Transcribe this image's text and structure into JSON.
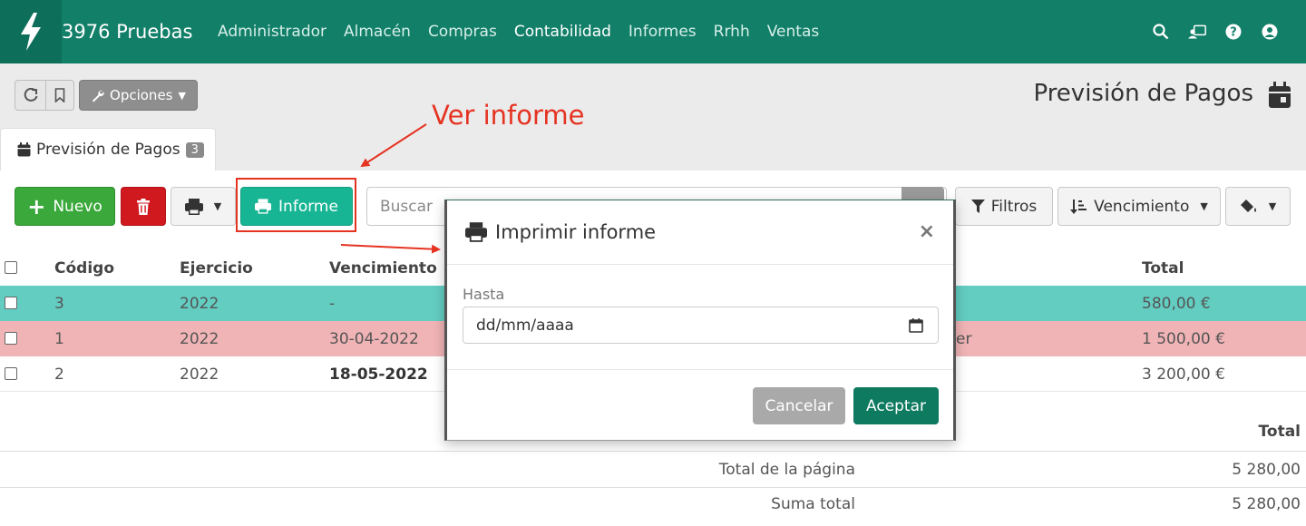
{
  "navbar": {
    "brand": "3976 Pruebas",
    "links": [
      "Administrador",
      "Almacén",
      "Compras",
      "Contabilidad",
      "Informes",
      "Rrhh",
      "Ventas"
    ],
    "active_link": "Contabilidad",
    "icons": [
      "search-icon",
      "contacts-icon",
      "help-icon",
      "user-icon"
    ]
  },
  "header": {
    "options_label": "Opciones",
    "page_title": "Previsión de Pagos",
    "tab_label": "Previsión de Pagos",
    "tab_count": "3"
  },
  "toolbar": {
    "new_label": "Nuevo",
    "report_label": "Informe",
    "search_placeholder": "Buscar",
    "filters_label": "Filtros",
    "sort_label": "Vencimiento"
  },
  "table": {
    "headers": [
      "Código",
      "Ejercicio",
      "Vencimiento",
      "Total"
    ],
    "rows": [
      {
        "codigo": "3",
        "ejercicio": "2022",
        "vencimiento": "-",
        "partial": "",
        "total": "580,00 €",
        "color": "#63cdc2"
      },
      {
        "codigo": "1",
        "ejercicio": "2022",
        "vencimiento": "30-04-2022",
        "partial": "er",
        "total": "1 500,00 €",
        "color": "#f0b4b6"
      },
      {
        "codigo": "2",
        "ejercicio": "2022",
        "vencimiento": "18-05-2022",
        "partial": "",
        "total": "3 200,00 €",
        "color": "#ffffff"
      }
    ]
  },
  "footer": {
    "total_header": "Total",
    "page_total_label": "Total de la página",
    "page_total_value": "5 280,00",
    "sum_label": "Suma total",
    "sum_value": "5 280,00"
  },
  "annotation": {
    "label": "Ver informe"
  },
  "modal": {
    "title": "Imprimir informe",
    "close": "×",
    "field_label": "Hasta",
    "date_placeholder": "dd/mm/aaaa",
    "cancel_label": "Cancelar",
    "accept_label": "Aceptar"
  }
}
